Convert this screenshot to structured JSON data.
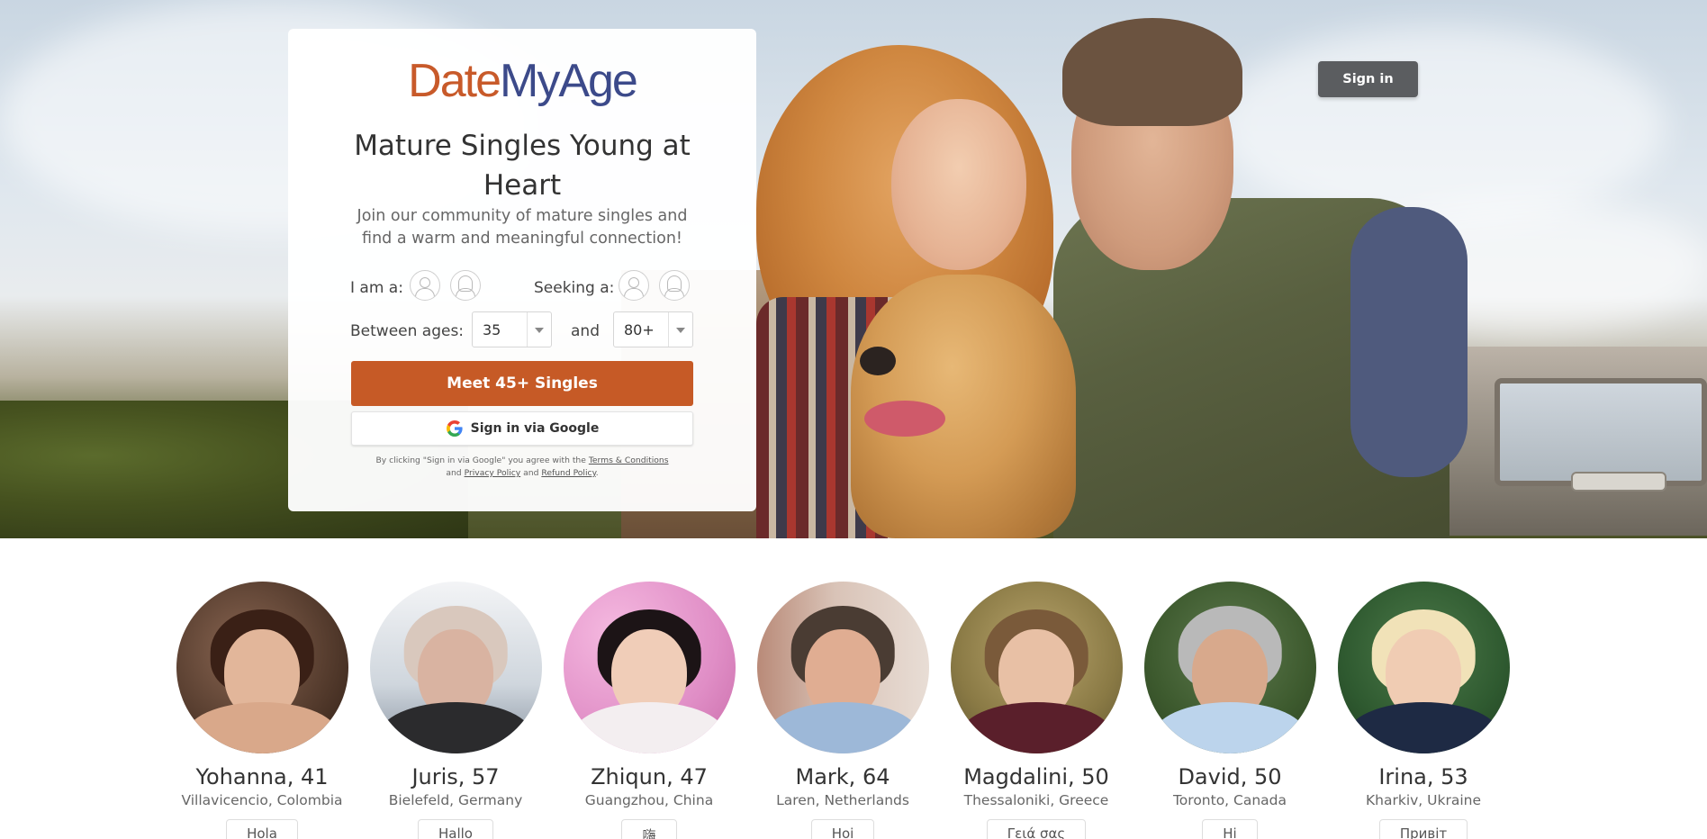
{
  "brand": {
    "logo_part1": "Date",
    "logo_part2": "MyAge",
    "color_primary": "#c85a2a",
    "color_secondary": "#3c4a8a"
  },
  "header": {
    "signin_label": "Sign in"
  },
  "signup": {
    "headline": "Mature Singles Young at Heart",
    "subline": "Join our community of mature singles and find a warm and meaningful connection!",
    "iam_label": "I am a:",
    "seeking_label": "Seeking a:",
    "between_label": "Between ages:",
    "and_label": "and",
    "age_min": "35",
    "age_max": "80+",
    "cta_label": "Meet 45+ Singles",
    "google_label": "Sign in via Google",
    "disclaimer_prefix": "By clicking \"Sign in via Google\" you agree with the",
    "terms_link": "Terms & Conditions",
    "and_word": "and",
    "privacy_link": "Privacy Policy",
    "and_word2": "and",
    "refund_link": "Refund Policy"
  },
  "profiles": [
    {
      "name": "Yohanna, 41",
      "location": "Villavicencio, Colombia",
      "greeting": "Hola"
    },
    {
      "name": "Juris, 57",
      "location": "Bielefeld, Germany",
      "greeting": "Hallo"
    },
    {
      "name": "Zhiqun, 47",
      "location": "Guangzhou, China",
      "greeting": "嗨"
    },
    {
      "name": "Mark, 64",
      "location": "Laren, Netherlands",
      "greeting": "Hoi"
    },
    {
      "name": "Magdalini, 50",
      "location": "Thessaloniki, Greece",
      "greeting": "Γειά σας"
    },
    {
      "name": "David, 50",
      "location": "Toronto, Canada",
      "greeting": "Hi"
    },
    {
      "name": "Irina, 53",
      "location": "Kharkiv, Ukraine",
      "greeting": "Привіт"
    }
  ]
}
